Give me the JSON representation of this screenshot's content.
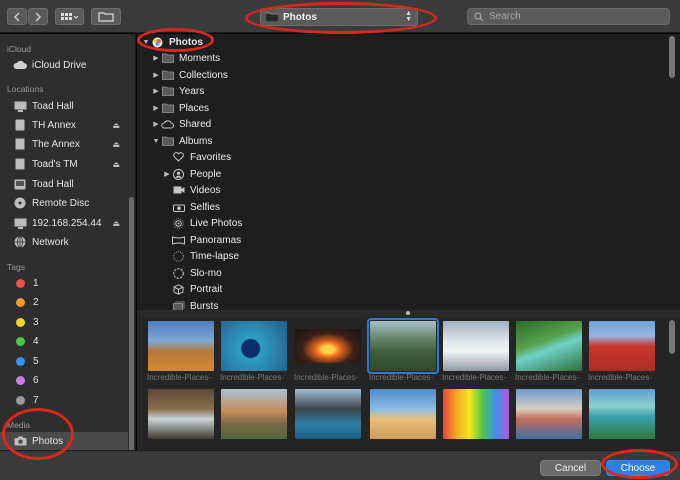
{
  "toolbar": {
    "back_icon": "chevron-left",
    "forward_icon": "chevron-right",
    "view_icon": "grid-view",
    "folder_icon": "new-folder",
    "path_label": "Photos",
    "search_placeholder": "Search"
  },
  "sidebar": {
    "sections": {
      "icloud": "iCloud",
      "locations": "Locations",
      "tags": "Tags",
      "media": "Media"
    },
    "icloud_items": [
      {
        "label": "iCloud Drive",
        "icon": "cloud"
      }
    ],
    "location_items": [
      {
        "label": "Toad Hall",
        "icon": "display",
        "eject": false
      },
      {
        "label": "TH Annex",
        "icon": "drive",
        "eject": true
      },
      {
        "label": "The Annex",
        "icon": "drive",
        "eject": true
      },
      {
        "label": "Toad's TM",
        "icon": "drive",
        "eject": true
      },
      {
        "label": "Toad Hall",
        "icon": "drive",
        "eject": false
      },
      {
        "label": "Remote Disc",
        "icon": "disc",
        "eject": false
      },
      {
        "label": "192.168.254.44",
        "icon": "display",
        "eject": true
      },
      {
        "label": "Network",
        "icon": "globe",
        "eject": false
      }
    ],
    "tag_items": [
      {
        "label": "1",
        "color": "#f0514b"
      },
      {
        "label": "2",
        "color": "#f59a23"
      },
      {
        "label": "3",
        "color": "#f5d32a"
      },
      {
        "label": "4",
        "color": "#4cc84a"
      },
      {
        "label": "5",
        "color": "#3d8ef0"
      },
      {
        "label": "6",
        "color": "#c77ee6"
      },
      {
        "label": "7",
        "color": "#9a9a9a"
      }
    ],
    "media_items": [
      {
        "label": "Photos",
        "icon": "camera"
      }
    ]
  },
  "tree": {
    "rows": [
      {
        "label": "Photos",
        "level": 0,
        "disclosure": "open",
        "icon": "photos-app",
        "bold": true
      },
      {
        "label": "Moments",
        "level": 1,
        "disclosure": "closed",
        "icon": "folder"
      },
      {
        "label": "Collections",
        "level": 1,
        "disclosure": "closed",
        "icon": "folder"
      },
      {
        "label": "Years",
        "level": 1,
        "disclosure": "closed",
        "icon": "folder"
      },
      {
        "label": "Places",
        "level": 1,
        "disclosure": "closed",
        "icon": "folder"
      },
      {
        "label": "Shared",
        "level": 1,
        "disclosure": "closed",
        "icon": "cloud"
      },
      {
        "label": "Albums",
        "level": 1,
        "disclosure": "open",
        "icon": "folder"
      },
      {
        "label": "Favorites",
        "level": 2,
        "disclosure": "none",
        "icon": "heart"
      },
      {
        "label": "People",
        "level": 2,
        "disclosure": "closed",
        "icon": "person"
      },
      {
        "label": "Videos",
        "level": 2,
        "disclosure": "none",
        "icon": "video"
      },
      {
        "label": "Selfies",
        "level": 2,
        "disclosure": "none",
        "icon": "camera"
      },
      {
        "label": "Live Photos",
        "level": 2,
        "disclosure": "none",
        "icon": "live"
      },
      {
        "label": "Panoramas",
        "level": 2,
        "disclosure": "none",
        "icon": "panorama"
      },
      {
        "label": "Time-lapse",
        "level": 2,
        "disclosure": "none",
        "icon": "timelapse"
      },
      {
        "label": "Slo-mo",
        "level": 2,
        "disclosure": "none",
        "icon": "slomo"
      },
      {
        "label": "Portrait",
        "level": 2,
        "disclosure": "none",
        "icon": "cube"
      },
      {
        "label": "Bursts",
        "level": 2,
        "disclosure": "none",
        "icon": "stack"
      }
    ]
  },
  "grid": {
    "captions": [
      "Incredible-Places-",
      "Incredible-Places-",
      "Incredible-Places-",
      "Incredible-Places-",
      "Incredible-Places-",
      "Incredible-Places-",
      "Incredible-Places-"
    ],
    "selected_index": 3
  },
  "buttons": {
    "cancel": "Cancel",
    "choose": "Choose"
  },
  "colors": {
    "accent": "#2f7fe0",
    "annotation": "#d9281c"
  }
}
